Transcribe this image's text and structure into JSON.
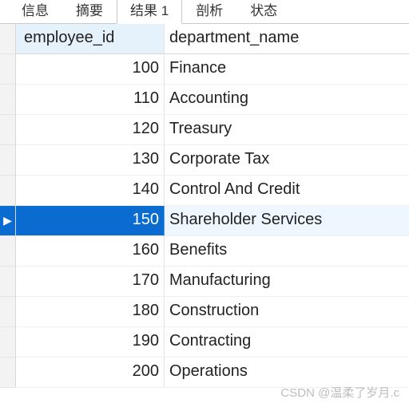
{
  "tabs": [
    {
      "label": "信息",
      "active": false
    },
    {
      "label": "摘要",
      "active": false
    },
    {
      "label": "结果 1",
      "active": true
    },
    {
      "label": "剖析",
      "active": false
    },
    {
      "label": "状态",
      "active": false
    }
  ],
  "headers": {
    "col1": "employee_id",
    "col2": "department_name"
  },
  "selected_row_index": 5,
  "row_marker": "▶",
  "rows": [
    {
      "employee_id": "100",
      "department_name": "Finance"
    },
    {
      "employee_id": "110",
      "department_name": "Accounting"
    },
    {
      "employee_id": "120",
      "department_name": "Treasury"
    },
    {
      "employee_id": "130",
      "department_name": "Corporate Tax"
    },
    {
      "employee_id": "140",
      "department_name": "Control And Credit"
    },
    {
      "employee_id": "150",
      "department_name": "Shareholder Services"
    },
    {
      "employee_id": "160",
      "department_name": "Benefits"
    },
    {
      "employee_id": "170",
      "department_name": "Manufacturing"
    },
    {
      "employee_id": "180",
      "department_name": "Construction"
    },
    {
      "employee_id": "190",
      "department_name": "Contracting"
    },
    {
      "employee_id": "200",
      "department_name": "Operations"
    }
  ],
  "watermark": "CSDN @温柔了岁月.c"
}
